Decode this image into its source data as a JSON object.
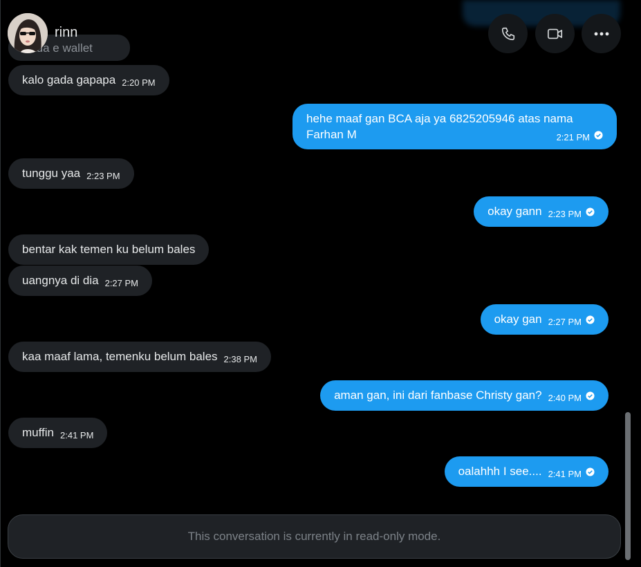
{
  "header": {
    "name": "rinn",
    "ghost_message": "o ada e wallet",
    "buttons": {
      "call": "phone-icon",
      "video": "video-icon",
      "more": "more-icon"
    }
  },
  "messages": [
    {
      "dir": "in",
      "text": "kalo gada gapapa",
      "time": "2:20 PM"
    },
    {
      "dir": "out",
      "text": "hehe maaf gan BCA aja ya 6825205946 atas nama Farhan M",
      "time": "2:21 PM",
      "status": "sent"
    },
    {
      "dir": "in",
      "text": "tunggu yaa",
      "time": "2:23 PM"
    },
    {
      "dir": "out",
      "text": "okay gann",
      "time": "2:23 PM",
      "status": "sent"
    },
    {
      "dir": "in",
      "text": "bentar kak temen ku belum bales",
      "time": ""
    },
    {
      "dir": "in",
      "text": "uangnya di dia",
      "time": "2:27 PM"
    },
    {
      "dir": "out",
      "text": "okay gan",
      "time": "2:27 PM",
      "status": "sent"
    },
    {
      "dir": "in",
      "text": "kaa maaf lama, temenku belum bales",
      "time": "2:38 PM"
    },
    {
      "dir": "out",
      "text": "aman gan, ini dari fanbase Christy gan?",
      "time": "2:40 PM",
      "status": "sent"
    },
    {
      "dir": "in",
      "text": "muffin",
      "time": "2:41 PM"
    },
    {
      "dir": "out",
      "text": "oalahhh I see....",
      "time": "2:41 PM",
      "status": "sent"
    }
  ],
  "footer": {
    "readonly_text": "This conversation is currently in read-only mode."
  },
  "colors": {
    "background": "#000000",
    "incoming": "#1f2226",
    "outgoing": "#1d9bf0",
    "muted": "#7c8288"
  }
}
